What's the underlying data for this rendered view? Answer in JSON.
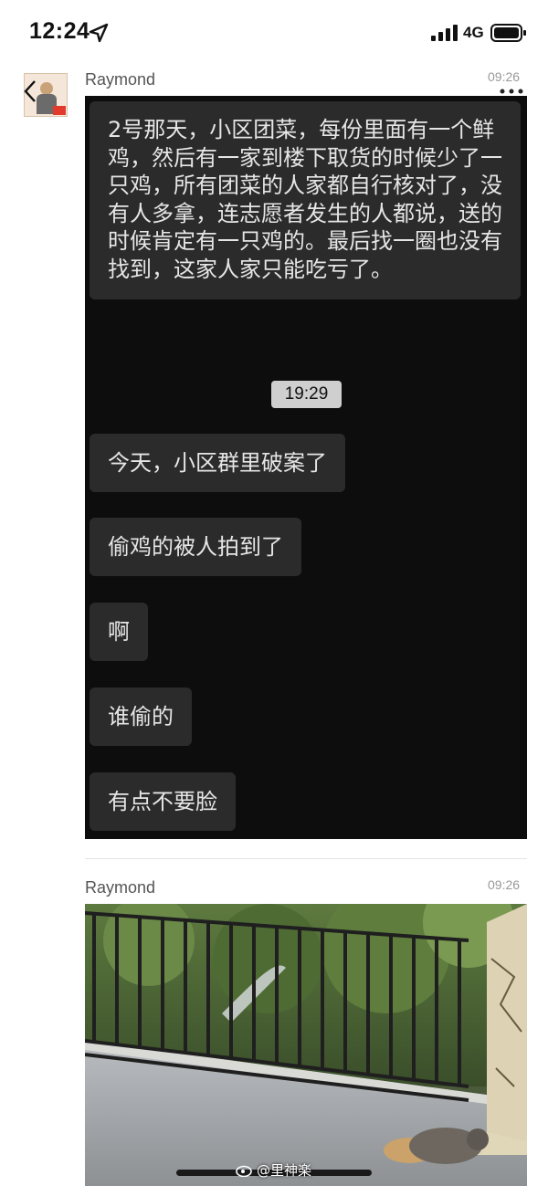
{
  "status_bar": {
    "time": "12:24",
    "network": "4G"
  },
  "post1": {
    "username": "Raymond",
    "time": "09:26",
    "screenshot": {
      "messages": [
        "2号那天，小区团菜，每份里面有一个鲜鸡，然后有一家到楼下取货的时候少了一只鸡，所有团菜的人家都自行核对了，没有人多拿，连志愿者发生的人都说，送的时候肯定有一只鸡的。最后找一圈也没有找到，这家人家只能吃亏了。"
      ],
      "time_chip": "19:29",
      "later_messages": [
        "今天，小区群里破案了",
        "偷鸡的被人拍到了",
        "啊",
        "谁偷的",
        "有点不要脸"
      ]
    }
  },
  "post2": {
    "username": "Raymond",
    "time": "09:26"
  },
  "watermark": "@里神楽",
  "colors": {
    "panel_bg": "#0d0d0d",
    "bubble_bg": "#2b2b2b",
    "bubble_text": "#e6e6e6",
    "time_chip_bg": "#cfcfcf"
  }
}
